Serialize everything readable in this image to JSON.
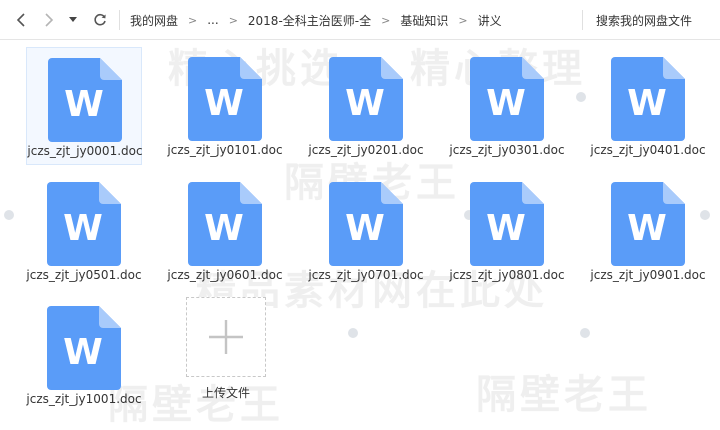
{
  "toolbar": {
    "back_icon": "chevron-left-icon",
    "forward_icon": "chevron-right-icon",
    "history_icon": "triangle-down-icon",
    "refresh_icon": "refresh-icon",
    "breadcrumb": [
      "我的网盘",
      "...",
      "2018-全科主治医师-全",
      "基础知识",
      "讲义"
    ],
    "search_placeholder": "搜索我的网盘文件"
  },
  "watermarks": [
    "精心挑选",
    "精心整理",
    "隔壁老王",
    "精品素材网在此处",
    "隔壁老王",
    "隔壁老王"
  ],
  "files": [
    {
      "name": "jczs_zjt_jy0001.doc",
      "icon_letter": "W",
      "selected": true
    },
    {
      "name": "jczs_zjt_jy0101.doc",
      "icon_letter": "W"
    },
    {
      "name": "jczs_zjt_jy0201.doc",
      "icon_letter": "W"
    },
    {
      "name": "jczs_zjt_jy0301.doc",
      "icon_letter": "W"
    },
    {
      "name": "jczs_zjt_jy0401.doc",
      "icon_letter": "W"
    },
    {
      "name": "jczs_zjt_jy0501.doc",
      "icon_letter": "W"
    },
    {
      "name": "jczs_zjt_jy0601.doc",
      "icon_letter": "W"
    },
    {
      "name": "jczs_zjt_jy0701.doc",
      "icon_letter": "W"
    },
    {
      "name": "jczs_zjt_jy0801.doc",
      "icon_letter": "W"
    },
    {
      "name": "jczs_zjt_jy0901.doc",
      "icon_letter": "W"
    },
    {
      "name": "jczs_zjt_jy1001.doc",
      "icon_letter": "W"
    }
  ],
  "upload": {
    "label": "上传文件",
    "icon": "plus-icon"
  },
  "colors": {
    "doc_blue": "#5a9cf8",
    "doc_fold": "#a9cbfb",
    "selected_bg": "#f3f8ff"
  }
}
